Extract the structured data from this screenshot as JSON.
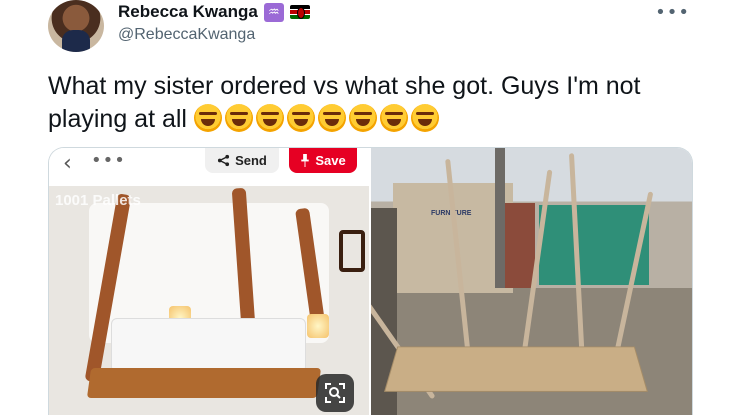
{
  "tweet": {
    "author": {
      "display_name": "Rebecca Kwanga",
      "handle": "@RebeccaKwanga",
      "badges": [
        "aquarius-icon",
        "kenya-flag-icon"
      ]
    },
    "text": "What my sister ordered vs what she got. Guys I'm not playing at all",
    "emoji_count": 8,
    "emoji": "rolling-on-floor-laughing-icon",
    "more_menu": "•••"
  },
  "media": {
    "left_image": {
      "back_glyph": "‹",
      "menu_glyph": "•••",
      "send_label": "Send",
      "save_label": "Save",
      "watermark": "1001 Pallets"
    },
    "right_image": {
      "shop_sign": "FURNITURE"
    }
  },
  "colors": {
    "text": "#0f1419",
    "secondary_text": "#536471",
    "save_red": "#e60023",
    "border": "#cfd9de"
  }
}
